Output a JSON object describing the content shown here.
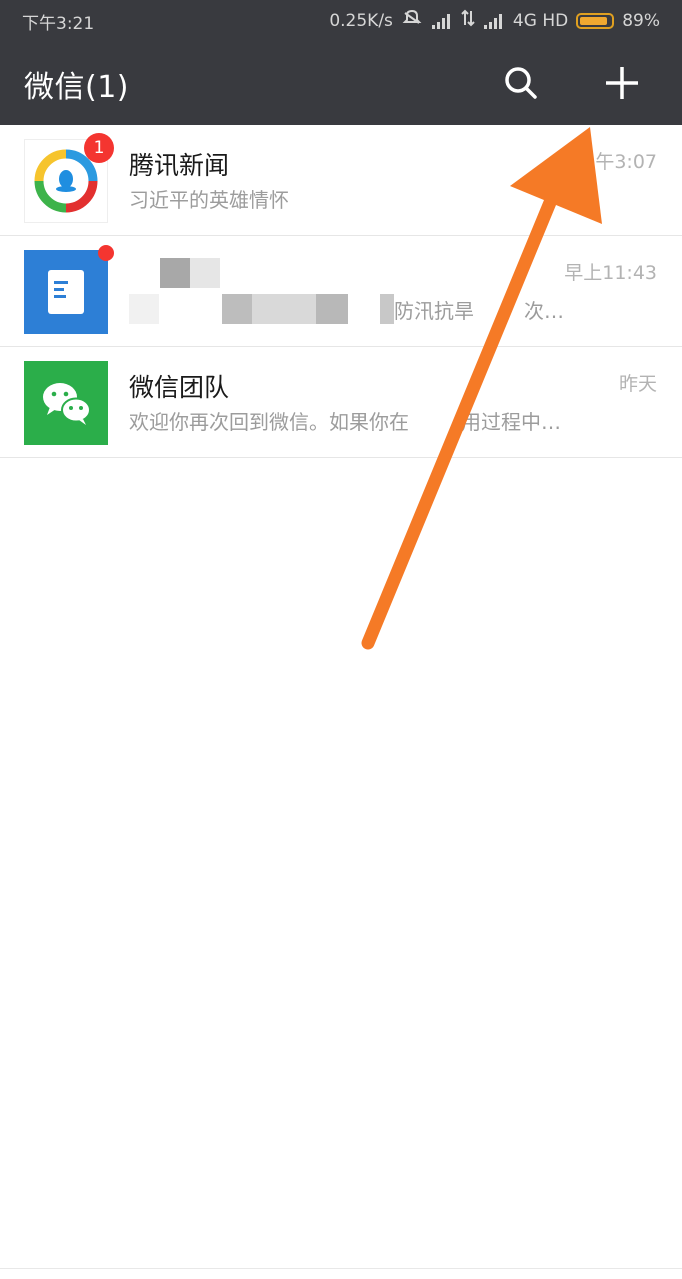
{
  "status_bar": {
    "time": "下午3:21",
    "net_speed": "0.25K/s",
    "network": "4G HD",
    "battery_level": 0.89,
    "battery_text": "89%"
  },
  "title_bar": {
    "title": "微信(1)",
    "icons": [
      "search-icon",
      "add-icon"
    ]
  },
  "chats": [
    {
      "name": "腾讯新闻",
      "preview": "习近平的英雄情怀",
      "time": "午3:07",
      "badge": "1",
      "avatar_icon": "tencent-news-logo"
    },
    {
      "name": "",
      "preview": "防汛抗旱",
      "preview_suffix": "次…",
      "time": "早上11:43",
      "avatar_icon": "document-icon"
    },
    {
      "name": "微信团队",
      "preview": "欢迎你再次回到微信。如果你在",
      "preview_suffix": "用过程中…",
      "time": "昨天",
      "avatar_icon": "wechat-logo"
    }
  ],
  "colors": {
    "header_bg": "#393a3f",
    "badge": "#f43530",
    "arrow": "#f57a26",
    "wechat_green": "#2bae4a",
    "doc_blue": "#2d7fd6"
  }
}
